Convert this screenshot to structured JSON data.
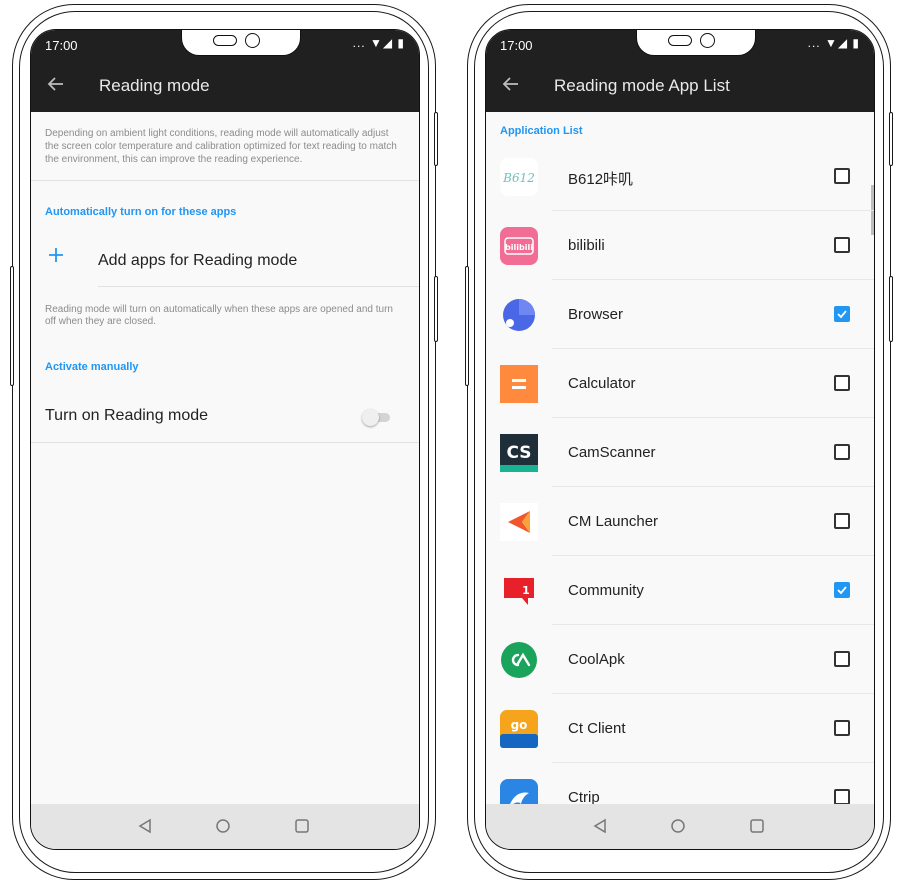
{
  "left": {
    "status": {
      "time": "17:00",
      "icons": "... ▼◢ ▮"
    },
    "title": "Reading mode",
    "description": "Depending on ambient light conditions, reading mode will automatically adjust the screen color temperature and calibration optimized for text reading to match the environment, this can improve the reading experience.",
    "section_auto": "Automatically turn on for these apps",
    "add_apps_label": "Add apps for Reading mode",
    "auto_note": "Reading mode will turn on automatically when these apps are opened and turn off when they are closed.",
    "section_manual": "Activate manually",
    "toggle_label": "Turn on Reading mode",
    "toggle_on": false
  },
  "right": {
    "status": {
      "time": "17:00",
      "icons": "... ▼◢ ▮"
    },
    "title": "Reading mode App List",
    "list_header": "Application List",
    "apps": [
      {
        "name": "B612咔叽",
        "checked": false,
        "icon": "b612-icon"
      },
      {
        "name": "bilibili",
        "checked": false,
        "icon": "bilibili-icon"
      },
      {
        "name": "Browser",
        "checked": true,
        "icon": "browser-icon"
      },
      {
        "name": "Calculator",
        "checked": false,
        "icon": "calculator-icon"
      },
      {
        "name": "CamScanner",
        "checked": false,
        "icon": "camscanner-icon"
      },
      {
        "name": "CM Launcher",
        "checked": false,
        "icon": "cm-launcher-icon"
      },
      {
        "name": "Community",
        "checked": true,
        "icon": "community-icon"
      },
      {
        "name": "CoolApk",
        "checked": false,
        "icon": "coolapk-icon"
      },
      {
        "name": "Ct Client",
        "checked": false,
        "icon": "ct-client-icon"
      },
      {
        "name": "Ctrip",
        "checked": false,
        "icon": "ctrip-icon"
      }
    ]
  },
  "colors": {
    "accent": "#2196f3",
    "appbar": "#202020",
    "navbar": "#e4e4e4"
  }
}
